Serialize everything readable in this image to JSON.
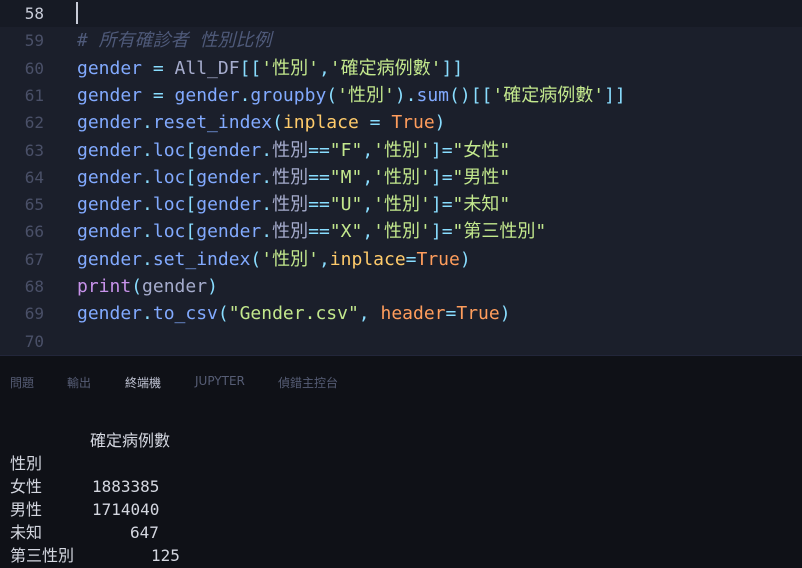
{
  "editor": {
    "lines": [
      {
        "num": "58",
        "active": true,
        "tokens": []
      },
      {
        "num": "59",
        "tokens": [
          [
            "c-cmt",
            "# 所有確診者 性別比例"
          ]
        ]
      },
      {
        "num": "60",
        "tokens": [
          [
            "c-var",
            "gender"
          ],
          [
            "c-op",
            " = "
          ],
          [
            "c-txt",
            "All_DF"
          ],
          [
            "c-pun",
            "[["
          ],
          [
            "c-str",
            "'性別'"
          ],
          [
            "c-pun",
            ","
          ],
          [
            "c-str",
            "'確定病例數'"
          ],
          [
            "c-pun",
            "]]"
          ]
        ]
      },
      {
        "num": "61",
        "tokens": [
          [
            "c-var",
            "gender"
          ],
          [
            "c-op",
            " = "
          ],
          [
            "c-var",
            "gender"
          ],
          [
            "c-pun",
            "."
          ],
          [
            "c-fn",
            "groupby"
          ],
          [
            "c-pun",
            "("
          ],
          [
            "c-str",
            "'性別'"
          ],
          [
            "c-pun",
            ")."
          ],
          [
            "c-fn",
            "sum"
          ],
          [
            "c-pun",
            "()[["
          ],
          [
            "c-str",
            "'確定病例數'"
          ],
          [
            "c-pun",
            "]]"
          ]
        ]
      },
      {
        "num": "62",
        "tokens": [
          [
            "c-var",
            "gender"
          ],
          [
            "c-pun",
            "."
          ],
          [
            "c-fn",
            "reset_index"
          ],
          [
            "c-pun",
            "("
          ],
          [
            "c-prm",
            "inplace"
          ],
          [
            "c-op",
            " = "
          ],
          [
            "c-kw",
            "True"
          ],
          [
            "c-pun",
            ")"
          ]
        ]
      },
      {
        "num": "63",
        "tokens": [
          [
            "c-var",
            "gender"
          ],
          [
            "c-pun",
            "."
          ],
          [
            "c-var",
            "loc"
          ],
          [
            "c-pun",
            "["
          ],
          [
            "c-var",
            "gender"
          ],
          [
            "c-pun",
            "."
          ],
          [
            "c-txt",
            "性別"
          ],
          [
            "c-op",
            "=="
          ],
          [
            "c-str",
            "\"F\""
          ],
          [
            "c-pun",
            ","
          ],
          [
            "c-str",
            "'性別'"
          ],
          [
            "c-pun",
            "]"
          ],
          [
            "c-op",
            "="
          ],
          [
            "c-str",
            "\"女性\""
          ]
        ]
      },
      {
        "num": "64",
        "tokens": [
          [
            "c-var",
            "gender"
          ],
          [
            "c-pun",
            "."
          ],
          [
            "c-var",
            "loc"
          ],
          [
            "c-pun",
            "["
          ],
          [
            "c-var",
            "gender"
          ],
          [
            "c-pun",
            "."
          ],
          [
            "c-txt",
            "性別"
          ],
          [
            "c-op",
            "=="
          ],
          [
            "c-str",
            "\"M\""
          ],
          [
            "c-pun",
            ","
          ],
          [
            "c-str",
            "'性別'"
          ],
          [
            "c-pun",
            "]"
          ],
          [
            "c-op",
            "="
          ],
          [
            "c-str",
            "\"男性\""
          ]
        ]
      },
      {
        "num": "65",
        "tokens": [
          [
            "c-var",
            "gender"
          ],
          [
            "c-pun",
            "."
          ],
          [
            "c-var",
            "loc"
          ],
          [
            "c-pun",
            "["
          ],
          [
            "c-var",
            "gender"
          ],
          [
            "c-pun",
            "."
          ],
          [
            "c-txt",
            "性別"
          ],
          [
            "c-op",
            "=="
          ],
          [
            "c-str",
            "\"U\""
          ],
          [
            "c-pun",
            ","
          ],
          [
            "c-str",
            "'性別'"
          ],
          [
            "c-pun",
            "]"
          ],
          [
            "c-op",
            "="
          ],
          [
            "c-str",
            "\"未知\""
          ]
        ]
      },
      {
        "num": "66",
        "tokens": [
          [
            "c-var",
            "gender"
          ],
          [
            "c-pun",
            "."
          ],
          [
            "c-var",
            "loc"
          ],
          [
            "c-pun",
            "["
          ],
          [
            "c-var",
            "gender"
          ],
          [
            "c-pun",
            "."
          ],
          [
            "c-txt",
            "性別"
          ],
          [
            "c-op",
            "=="
          ],
          [
            "c-str",
            "\"X\""
          ],
          [
            "c-pun",
            ","
          ],
          [
            "c-str",
            "'性別'"
          ],
          [
            "c-pun",
            "]"
          ],
          [
            "c-op",
            "="
          ],
          [
            "c-str",
            "\"第三性別\""
          ]
        ]
      },
      {
        "num": "67",
        "tokens": [
          [
            "c-var",
            "gender"
          ],
          [
            "c-pun",
            "."
          ],
          [
            "c-fn",
            "set_index"
          ],
          [
            "c-pun",
            "("
          ],
          [
            "c-str",
            "'性別'"
          ],
          [
            "c-pun",
            ","
          ],
          [
            "c-prm",
            "inplace"
          ],
          [
            "c-op",
            "="
          ],
          [
            "c-kw",
            "True"
          ],
          [
            "c-pun",
            ")"
          ]
        ]
      },
      {
        "num": "68",
        "tokens": [
          [
            "c-bi",
            "print"
          ],
          [
            "c-pun",
            "("
          ],
          [
            "c-txt",
            "gender"
          ],
          [
            "c-pun",
            ")"
          ]
        ]
      },
      {
        "num": "69",
        "tokens": [
          [
            "c-var",
            "gender"
          ],
          [
            "c-pun",
            "."
          ],
          [
            "c-fn",
            "to_csv"
          ],
          [
            "c-pun",
            "("
          ],
          [
            "c-str",
            "\"Gender.csv\""
          ],
          [
            "c-pun",
            ", "
          ],
          [
            "c-kw",
            "header"
          ],
          [
            "c-op",
            "="
          ],
          [
            "c-kw",
            "True"
          ],
          [
            "c-pun",
            ")"
          ]
        ]
      },
      {
        "num": "70",
        "tokens": []
      }
    ]
  },
  "panel": {
    "tabs": [
      {
        "label": "問題",
        "active": false
      },
      {
        "label": "輸出",
        "active": false
      },
      {
        "label": "終端機",
        "active": true
      },
      {
        "label": "JUPYTER",
        "active": false
      },
      {
        "label": "偵錯主控台",
        "active": false
      }
    ]
  },
  "terminal": {
    "column_header": "確定病例數",
    "index_name": "性別",
    "rows": [
      {
        "label": "女性",
        "value": "1883385"
      },
      {
        "label": "男性",
        "value": "1714040"
      },
      {
        "label": "未知",
        "value": "647"
      },
      {
        "label": "第三性別",
        "value": "125"
      }
    ]
  }
}
